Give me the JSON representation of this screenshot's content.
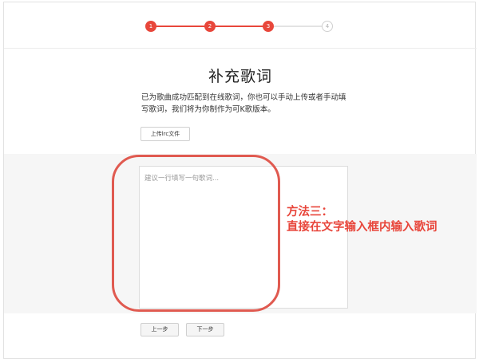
{
  "stepper": {
    "steps": [
      {
        "label": "1",
        "state": "done"
      },
      {
        "label": "2",
        "state": "done"
      },
      {
        "label": "3",
        "state": "current"
      },
      {
        "label": "4",
        "state": "todo"
      }
    ],
    "active_color": "#e8473b",
    "inactive_color": "#e3e3e3"
  },
  "main": {
    "title": "补充歌词",
    "description": "已为歌曲成功匹配到在线歌词，你也可以手动上传或者手动填写歌词，我们将为你制作为可K歌版本。",
    "upload_button": "上传lrc文件"
  },
  "lyrics": {
    "value": "",
    "placeholder": "建议一行填写一句歌词..."
  },
  "nav": {
    "prev_label": "上一步",
    "next_label": "下一步"
  },
  "annotation": {
    "line1": "方法三：",
    "line2": "直接在文字输入框内输入歌词",
    "color": "#e8463b"
  }
}
